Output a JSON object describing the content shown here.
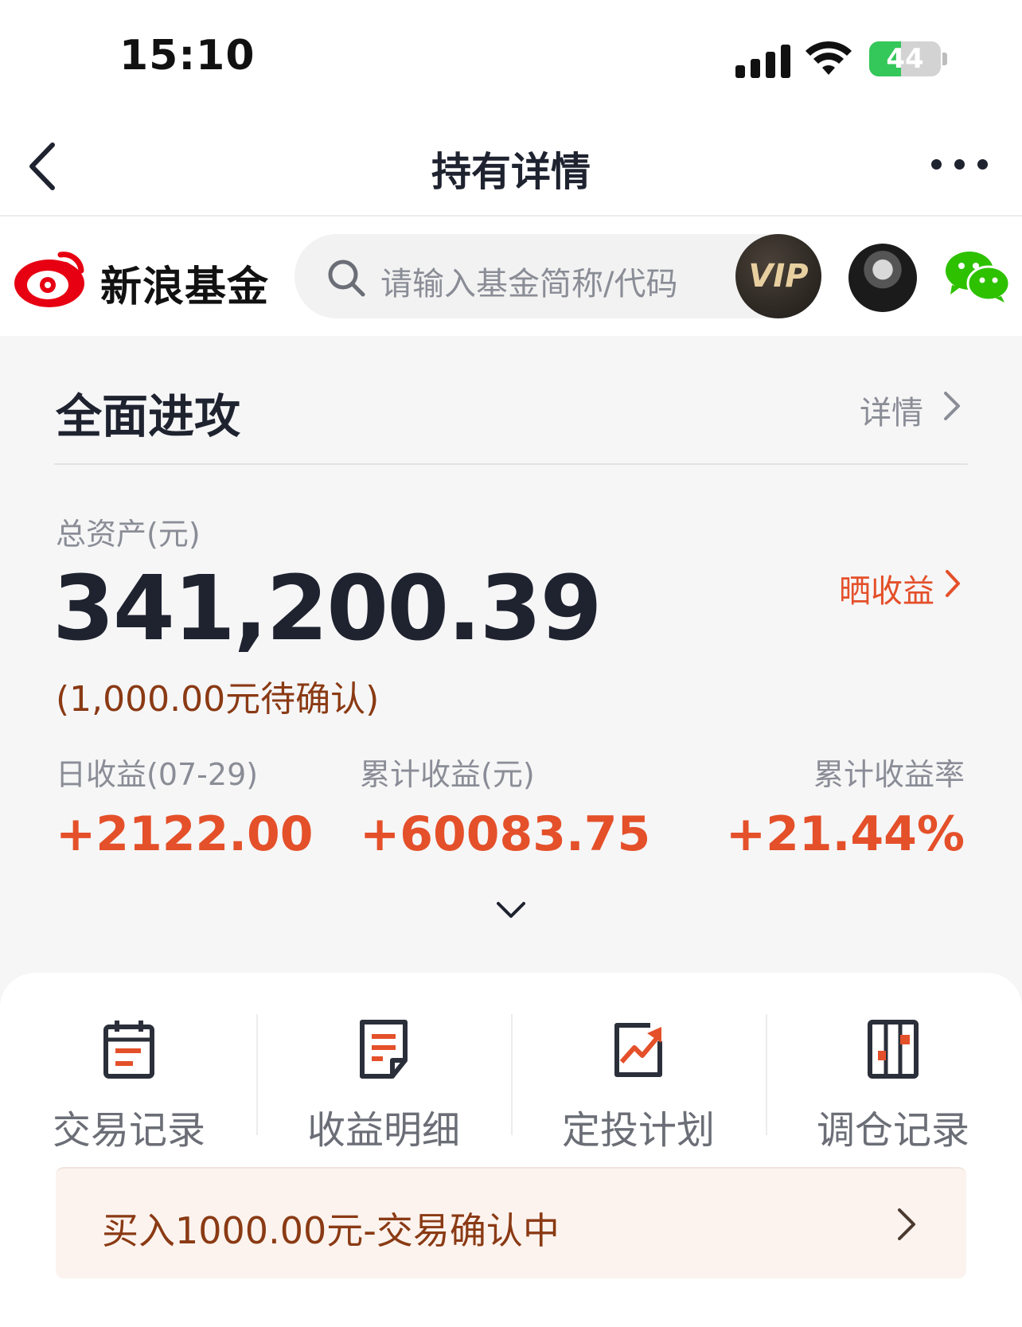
{
  "status_bar": {
    "time": "15:10",
    "battery": "44",
    "battery_level": 0.44
  },
  "nav": {
    "title": "持有详情"
  },
  "brand": {
    "name": "新浪基金",
    "search_placeholder": "请输入基金简称/代码",
    "vip_label": "VIP"
  },
  "summary": {
    "fund_name": "全面进攻",
    "detail_link": "详情",
    "total_label": "总资产(元)",
    "total_value": "341,200.39",
    "share_link": "晒收益",
    "pending_text": "(1,000.00元待确认)",
    "stats": [
      {
        "label": "日收益(07-29)",
        "value": "+2122.00"
      },
      {
        "label": "累计收益(元)",
        "value": "+60083.75"
      },
      {
        "label": "累计收益率",
        "value": "+21.44%"
      }
    ]
  },
  "actions": [
    {
      "label": "交易记录",
      "icon": "calendar-list-icon"
    },
    {
      "label": "收益明细",
      "icon": "document-icon"
    },
    {
      "label": "定投计划",
      "icon": "trend-chart-icon"
    },
    {
      "label": "调仓记录",
      "icon": "rebalance-icon"
    }
  ],
  "notice": {
    "text": "买入1000.00元-交易确认中"
  },
  "colors": {
    "accent": "#e4502a",
    "brand_red": "#e60012",
    "text_primary": "#1f2330",
    "text_secondary": "#8a8d96",
    "pending_brown": "#8a3a14",
    "wechat_green": "#2dc100",
    "battery_green": "#34c759"
  }
}
